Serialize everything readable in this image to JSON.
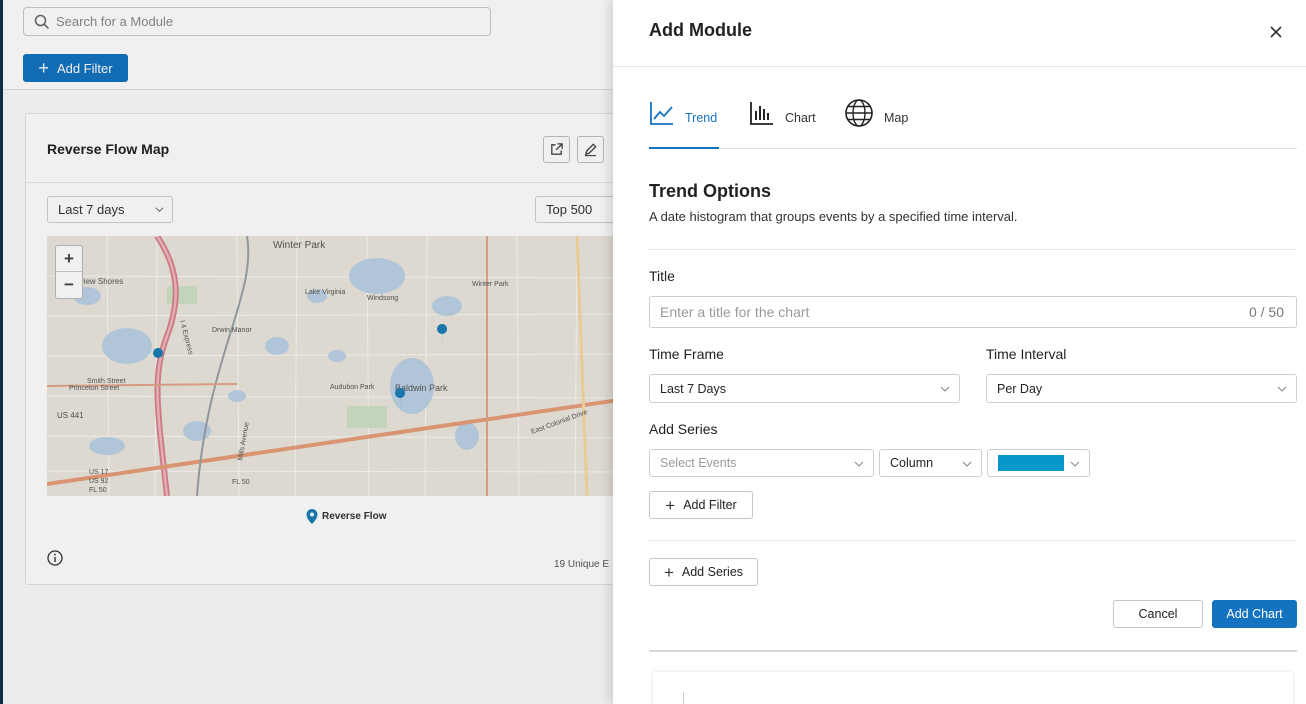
{
  "background": {
    "search": {
      "placeholder": "Search for a Module"
    },
    "add_filter_label": "Add Filter",
    "card": {
      "title": "Reverse Flow Map",
      "time_select": "Last 7 days",
      "limit_select": "Top 500",
      "legend_label": "Reverse Flow",
      "unique_count": "19 Unique E"
    },
    "map_labels": [
      "Winter Park",
      "Winter Park",
      "rview Shores",
      "Smith Street",
      "Princeton Street",
      "US 441",
      "Drwin Manor",
      "Windsong",
      "Lake Virginia",
      "Baldwin Park",
      "Audubon Park",
      "US 17",
      "US 92",
      "FL 50",
      "FL 50",
      "East Colonial Drive",
      "Mills Avenue",
      "I 4 Express"
    ]
  },
  "drawer": {
    "title": "Add Module",
    "tabs": [
      {
        "label": "Trend",
        "icon": "trend-line-icon",
        "active": true
      },
      {
        "label": "Chart",
        "icon": "bar-chart-icon",
        "active": false
      },
      {
        "label": "Map",
        "icon": "globe-icon",
        "active": false
      }
    ],
    "section_title": "Trend Options",
    "section_desc": "A date histogram that groups events by a specified time interval.",
    "title_field": {
      "label": "Title",
      "placeholder": "Enter a title for the chart",
      "count": "0 / 50"
    },
    "time_frame": {
      "label": "Time Frame",
      "value": "Last 7 Days"
    },
    "time_interval": {
      "label": "Time Interval",
      "value": "Per Day"
    },
    "add_series": {
      "label": "Add Series",
      "events_placeholder": "Select Events",
      "type_value": "Column",
      "color": "#0897c9"
    },
    "add_filter_label": "Add Filter",
    "add_series_button": "Add Series",
    "cancel_label": "Cancel",
    "add_chart_label": "Add Chart"
  },
  "colors": {
    "accent": "#1473c0",
    "series": "#0897c9",
    "marker": "#1a7fb5"
  }
}
